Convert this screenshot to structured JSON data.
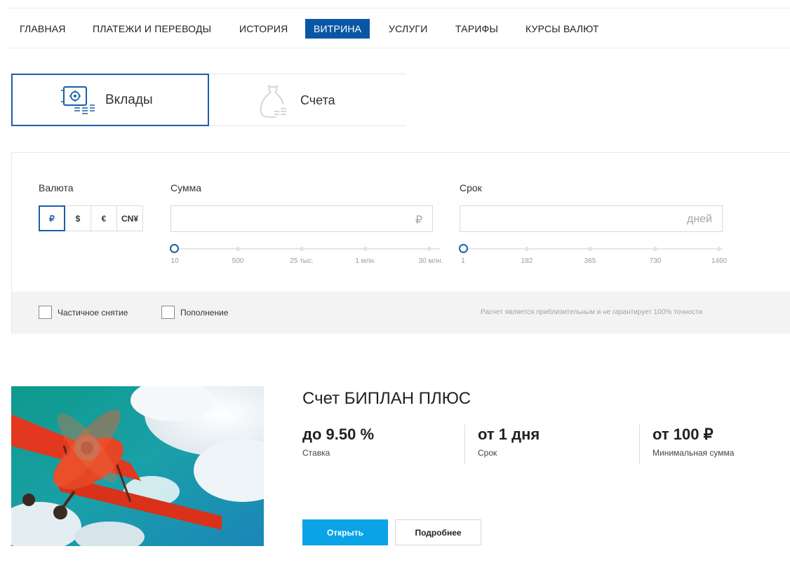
{
  "nav": {
    "items": [
      {
        "label": "ГЛАВНАЯ",
        "active": false
      },
      {
        "label": "ПЛАТЕЖИ И ПЕРЕВОДЫ",
        "active": false
      },
      {
        "label": "ИСТОРИЯ",
        "active": false
      },
      {
        "label": "ВИТРИНА",
        "active": true
      },
      {
        "label": "УСЛУГИ",
        "active": false
      },
      {
        "label": "ТАРИФЫ",
        "active": false
      },
      {
        "label": "КУРСЫ ВАЛЮТ",
        "active": false
      }
    ]
  },
  "product_tabs": {
    "deposits": {
      "label": "Вклады",
      "icon": "safe-icon",
      "selected": true
    },
    "accounts": {
      "label": "Счета",
      "icon": "money-bag-icon",
      "selected": false
    }
  },
  "calculator": {
    "currency": {
      "label": "Валюта",
      "options": [
        "₽",
        "$",
        "€",
        "CN¥"
      ],
      "selected": "₽"
    },
    "amount": {
      "label": "Сумма",
      "value": "",
      "suffix": "₽",
      "slider_ticks": [
        "10",
        "500",
        "25 тыс.",
        "1 млн.",
        "30 млн."
      ],
      "slider_position": 0
    },
    "term": {
      "label": "Срок",
      "value": "",
      "suffix": "дней",
      "slider_ticks": [
        "1",
        "182",
        "365",
        "730",
        "1460"
      ],
      "slider_position": 0
    },
    "options": {
      "partial_withdrawal": {
        "label": "Частичное снятие",
        "checked": false
      },
      "replenishment": {
        "label": "Пополнение",
        "checked": false
      }
    },
    "disclaimer": "Расчет является приблизительным и не гарантирует 100% точности"
  },
  "product": {
    "title": "Счет БИПЛАН ПЛЮС",
    "stats": [
      {
        "value": "до 9.50 %",
        "caption": "Ставка"
      },
      {
        "value": "от 1 дня",
        "caption": "Срок"
      },
      {
        "value": "от 100 ₽",
        "caption": "Минимальная сумма"
      }
    ],
    "open_label": "Открыть",
    "more_label": "Подробнее"
  },
  "colors": {
    "brand_blue": "#0a56a6",
    "accent_blue": "#1b5fa8",
    "open_button": "#0aa3e8",
    "image_sky": "#1a9aa6",
    "plane_red": "#e2381f"
  }
}
